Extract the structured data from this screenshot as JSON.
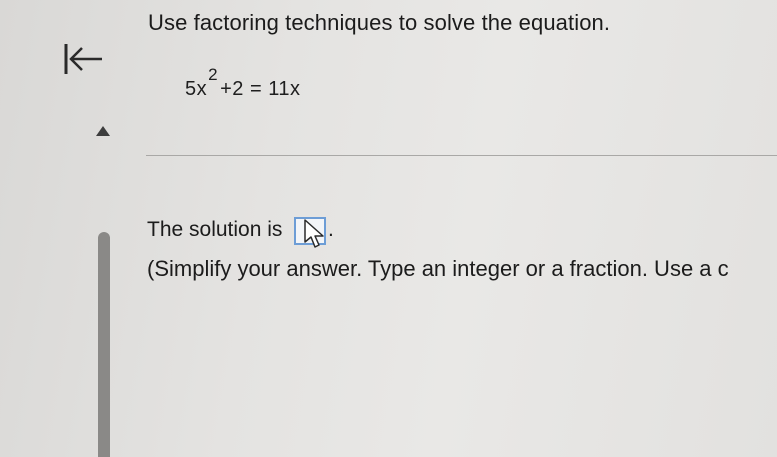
{
  "question": {
    "instruction": "Use factoring techniques to solve the equation.",
    "equation": {
      "lhs_base": "5x",
      "exponent": "2",
      "rest": "+2 = 11x"
    }
  },
  "navigation": {
    "back_icon": "arrow-left-to-bar-icon",
    "toggle_icon": "triangle-up-icon"
  },
  "answer": {
    "prefix": "The solution is",
    "suffix": ".",
    "value": "",
    "hint": "(Simplify your answer. Type an integer or a fraction. Use a c"
  },
  "colors": {
    "answer_box_border": "#6d9dd6",
    "text": "#1c1c1c",
    "scrollbar": "#8a8987"
  }
}
